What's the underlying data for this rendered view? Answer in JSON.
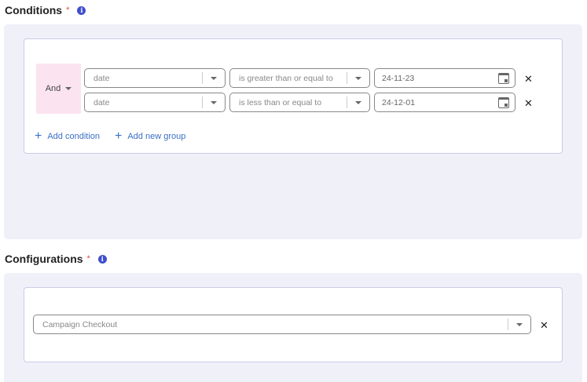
{
  "conditions": {
    "title": "Conditions",
    "required_mark": "*",
    "info_icon": "info-icon",
    "operator": "And",
    "rows": [
      {
        "field": "date",
        "comparator": "is greater than or equal to",
        "value": "24-11-23"
      },
      {
        "field": "date",
        "comparator": "is less than or equal to",
        "value": "24-12-01"
      }
    ],
    "add_condition_label": "Add condition",
    "add_group_label": "Add new group"
  },
  "configurations": {
    "title": "Configurations",
    "required_mark": "*",
    "info_icon": "info-icon",
    "selected": "Campaign Checkout"
  },
  "colors": {
    "accent": "#3a6fc4",
    "required": "#e5483f",
    "info": "#3f4fcf",
    "panel_bg": "#f0f0f9",
    "and_bg": "#fbe4f0"
  }
}
